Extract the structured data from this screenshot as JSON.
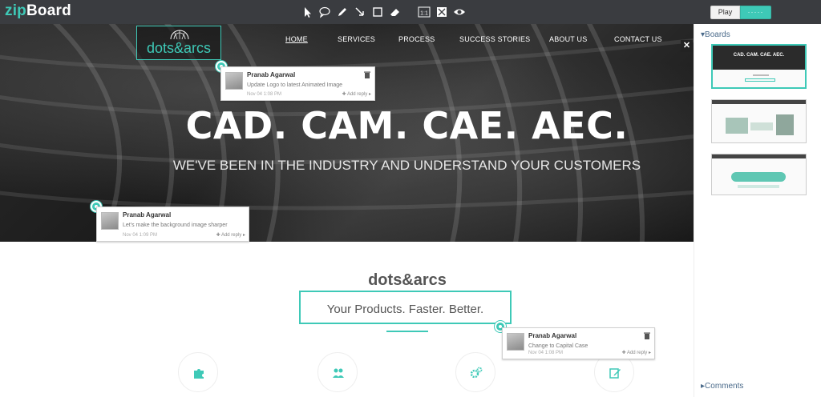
{
  "app": {
    "brand_prefix": "zip",
    "brand_suffix": "Board",
    "accent_color": "#3ec9b7",
    "toolbar_icons": [
      "pointer-icon",
      "comment-bubble-icon",
      "pencil-icon",
      "arrow-icon",
      "rectangle-icon",
      "eraser-icon",
      "actual-size-icon",
      "fit-screen-icon",
      "eye-icon"
    ],
    "play_label": "Play",
    "pause_label": "·····"
  },
  "site": {
    "logo_text": "dots&arcs",
    "nav": [
      "HOME",
      "SERVICES",
      "PROCESS",
      "SUCCESS STORIES",
      "ABOUT US",
      "CONTACT US"
    ],
    "hero_title": "CAD. CAM. CAE. AEC.",
    "hero_subtitle": "WE'VE BEEN IN THE INDUSTRY AND UNDERSTAND YOUR CUSTOMERS",
    "brand_heading": "dots&arcs",
    "tagline": "Your Products. Faster. Better.",
    "feature_icons": [
      "puzzle-icon",
      "people-icon",
      "gears-icon",
      "edit-icon"
    ]
  },
  "comments": [
    {
      "author": "Pranab Agarwal",
      "message": "Update Logo to latest Animated Image",
      "time": "Nov 04 1:08 PM",
      "reply_label": "Add reply"
    },
    {
      "author": "Pranab Agarwal",
      "message": "Let's make the background image sharper",
      "time": "Nov 04 1:09 PM",
      "reply_label": "Add reply"
    },
    {
      "author": "Pranab Agarwal",
      "message": "Change to Capital Case",
      "time": "Nov 04 1:08 PM",
      "reply_label": "Add reply"
    }
  ],
  "sidebar": {
    "boards_label": "Boards",
    "comments_label": "Comments",
    "thumb_title": "CAD. CAM. CAE. AEC."
  }
}
